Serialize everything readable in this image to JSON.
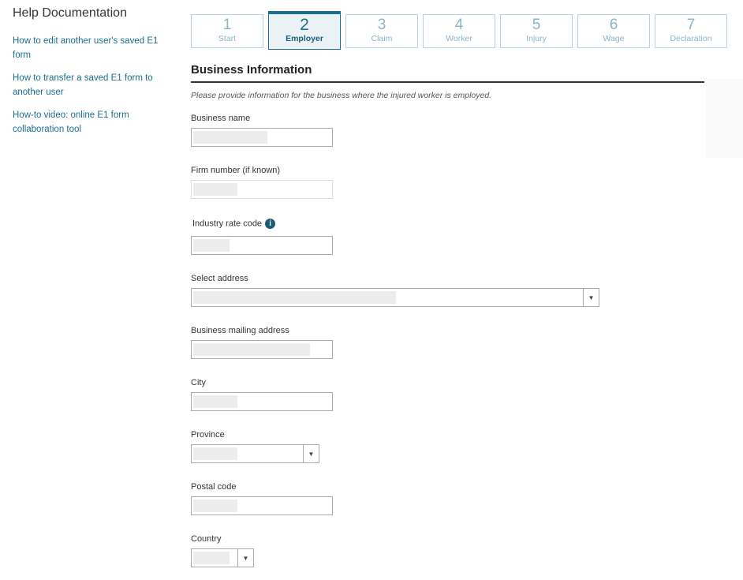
{
  "sidebar": {
    "title": "Help Documentation",
    "links": [
      "How to edit another user's saved E1 form",
      "How to transfer a saved E1 form to another user",
      "How-to video: online E1 form collaboration tool"
    ]
  },
  "steps": [
    {
      "num": "1",
      "label": "Start"
    },
    {
      "num": "2",
      "label": "Employer",
      "active": true
    },
    {
      "num": "3",
      "label": "Claim"
    },
    {
      "num": "4",
      "label": "Worker"
    },
    {
      "num": "5",
      "label": "Injury"
    },
    {
      "num": "6",
      "label": "Wage"
    },
    {
      "num": "7",
      "label": "Declaration"
    }
  ],
  "section": {
    "title": "Business Information",
    "intro": "Please provide information for the business where the injured worker is employed."
  },
  "fields": {
    "business_name": "Business name",
    "firm_number": "Firm number (if known)",
    "industry_rate_code": "Industry rate code",
    "select_address": "Select address",
    "mailing_address": "Business mailing address",
    "city": "City",
    "province": "Province",
    "postal_code": "Postal code",
    "country": "Country"
  },
  "icons": {
    "info": "i",
    "dropdown_caret": "▼"
  },
  "colors": {
    "accent": "#1a6f8f",
    "step_inactive": "#8db3c5",
    "step_active_bg": "#eaf2f6"
  }
}
